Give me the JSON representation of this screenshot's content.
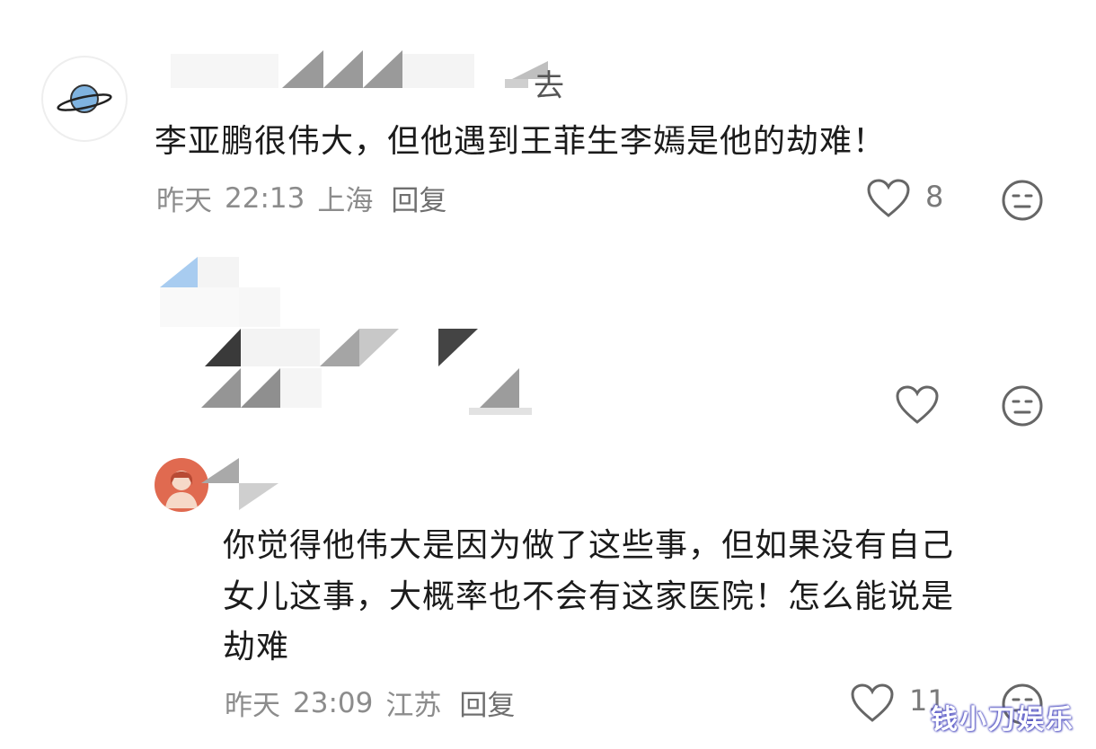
{
  "comments": [
    {
      "name_visible_tail": "去",
      "text": "李亚鹏很伟大，但他遇到王菲生李嫣是他的劫难！",
      "date": "昨天",
      "time": "22:13",
      "location": "上海",
      "reply_label": "回复",
      "like_count": "8"
    },
    {
      "like_count": ""
    },
    {
      "text_lines": [
        "你觉得他伟大是因为做了这些事，但如果没有自己",
        "女儿这事，大概率也不会有这家医院！怎么能说是",
        "劫难"
      ],
      "date": "昨天",
      "time": "23:09",
      "location": "江苏",
      "reply_label": "回复",
      "like_count": "11"
    }
  ],
  "watermark": "钱小刀娱乐",
  "icons": {
    "like": "heart-outline-icon",
    "dislike": "neutral-face-icon",
    "avatar_1": "planet-icon",
    "avatar_2": "person-icon"
  },
  "colors": {
    "text": "#1b1b1b",
    "meta": "#8c8c8c",
    "avatar_2_bg": "#e06a50",
    "planet": "#6fa8dc"
  }
}
